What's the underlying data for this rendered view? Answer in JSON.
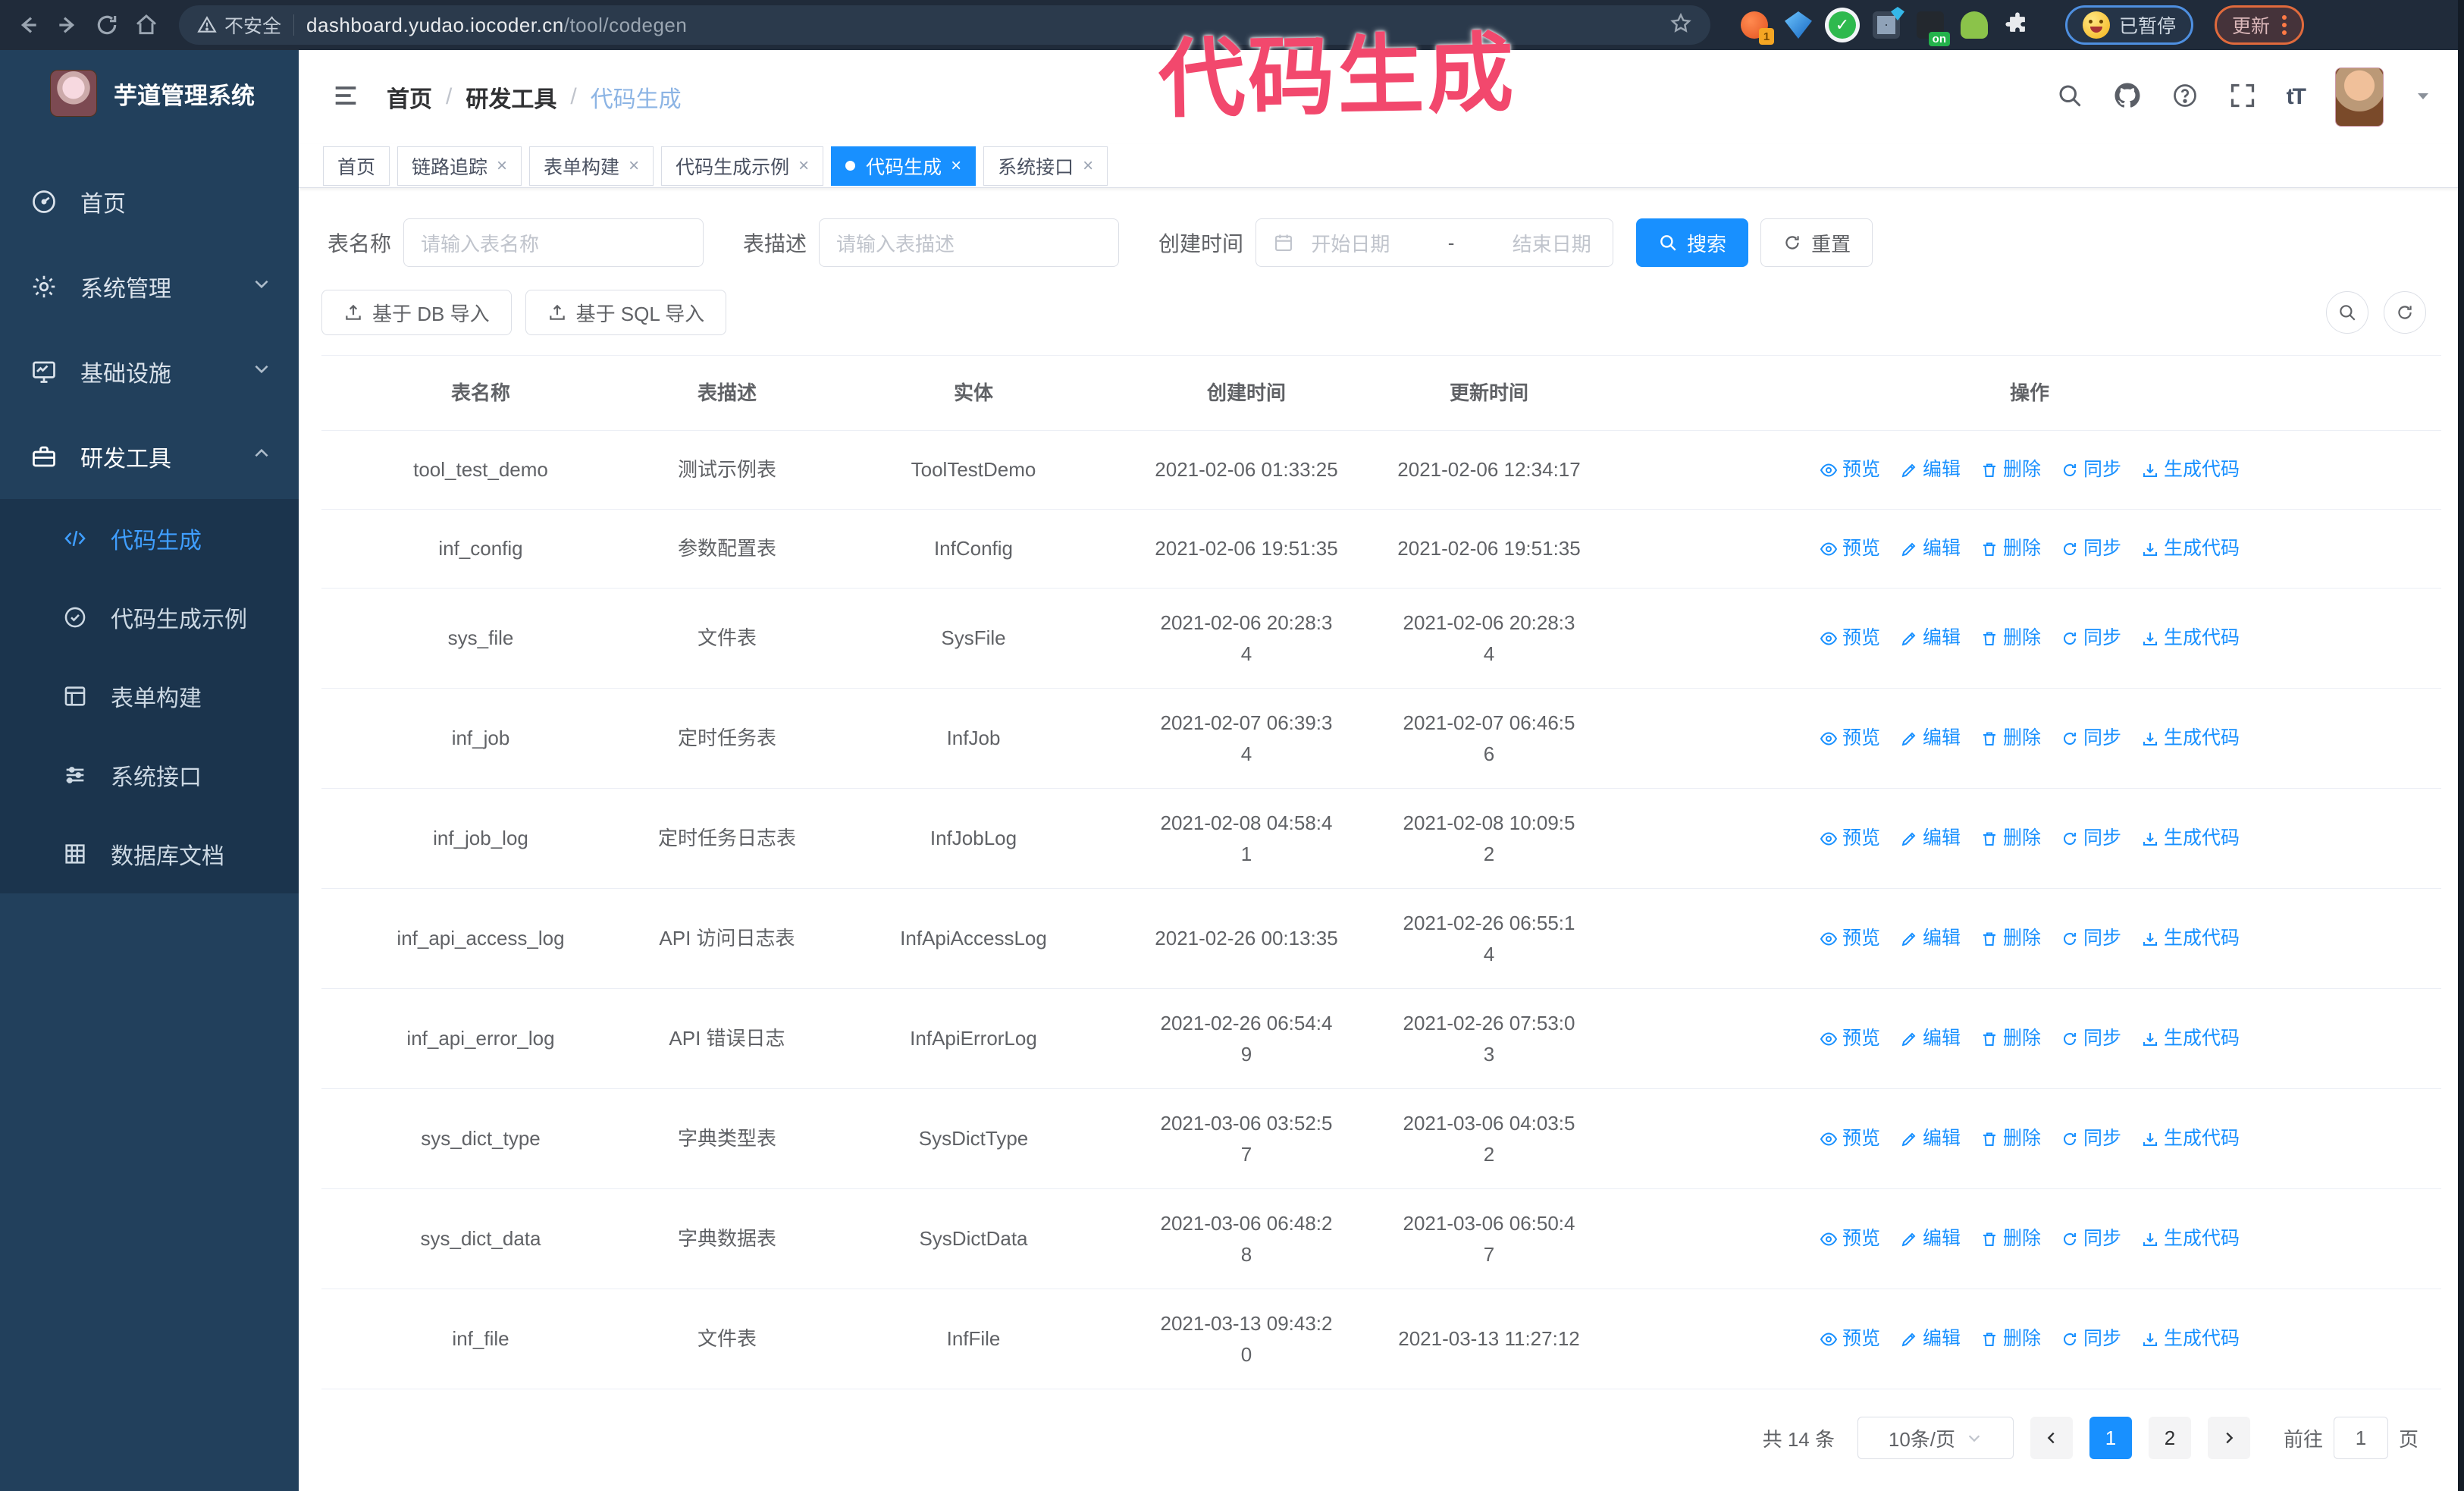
{
  "browser": {
    "security_warning": "不安全",
    "url_host": "dashboard.yudao.iocoder.cn",
    "url_path": "/tool/codegen",
    "paused_badge": "已暂停",
    "update_button": "更新"
  },
  "annotation": {
    "text": "代码生成",
    "color": "#f2486d"
  },
  "sidebar": {
    "app_title": "芋道管理系统",
    "items": [
      {
        "label": "首页"
      },
      {
        "label": "系统管理"
      },
      {
        "label": "基础设施"
      },
      {
        "label": "研发工具"
      }
    ],
    "submenu": [
      {
        "label": "代码生成"
      },
      {
        "label": "代码生成示例"
      },
      {
        "label": "表单构建"
      },
      {
        "label": "系统接口"
      },
      {
        "label": "数据库文档"
      }
    ]
  },
  "header": {
    "breadcrumb": {
      "home": "首页",
      "group": "研发工具",
      "current": "代码生成",
      "separator": "/"
    },
    "icons": {
      "font_size": "tT"
    }
  },
  "tabs": [
    {
      "label": "首页"
    },
    {
      "label": "链路追踪"
    },
    {
      "label": "表单构建"
    },
    {
      "label": "代码生成示例"
    },
    {
      "label": "代码生成"
    },
    {
      "label": "系统接口"
    }
  ],
  "tab_close_glyph": "×",
  "filters": {
    "table_name_label": "表名称",
    "table_name_placeholder": "请输入表名称",
    "table_desc_label": "表描述",
    "table_desc_placeholder": "请输入表描述",
    "create_time_label": "创建时间",
    "date_start_placeholder": "开始日期",
    "date_separator": "-",
    "date_end_placeholder": "结束日期",
    "search_button": "搜索",
    "reset_button": "重置",
    "import_db_button": "基于 DB 导入",
    "import_sql_button": "基于 SQL 导入"
  },
  "table": {
    "columns": [
      "表名称",
      "表描述",
      "实体",
      "创建时间",
      "更新时间",
      "操作"
    ],
    "actions": [
      "预览",
      "编辑",
      "删除",
      "同步",
      "生成代码"
    ],
    "rows": [
      {
        "name": "tool_test_demo",
        "desc": "测试示例表",
        "entity": "ToolTestDemo",
        "created": "2021-02-06 01:33:25",
        "updated": "2021-02-06 12:34:17"
      },
      {
        "name": "inf_config",
        "desc": "参数配置表",
        "entity": "InfConfig",
        "created": "2021-02-06 19:51:35",
        "updated": "2021-02-06 19:51:35"
      },
      {
        "name": "sys_file",
        "desc": "文件表",
        "entity": "SysFile",
        "created": "2021-02-06 20:28:34",
        "updated": "2021-02-06 20:28:34"
      },
      {
        "name": "inf_job",
        "desc": "定时任务表",
        "entity": "InfJob",
        "created": "2021-02-07 06:39:34",
        "updated": "2021-02-07 06:46:56"
      },
      {
        "name": "inf_job_log",
        "desc": "定时任务日志表",
        "entity": "InfJobLog",
        "created": "2021-02-08 04:58:41",
        "updated": "2021-02-08 10:09:52"
      },
      {
        "name": "inf_api_access_log",
        "desc": "API 访问日志表",
        "entity": "InfApiAccessLog",
        "created": "2021-02-26 00:13:35",
        "updated": "2021-02-26 06:55:14"
      },
      {
        "name": "inf_api_error_log",
        "desc": "API 错误日志",
        "entity": "InfApiErrorLog",
        "created": "2021-02-26 06:54:49",
        "updated": "2021-02-26 07:53:03"
      },
      {
        "name": "sys_dict_type",
        "desc": "字典类型表",
        "entity": "SysDictType",
        "created": "2021-03-06 03:52:57",
        "updated": "2021-03-06 04:03:52"
      },
      {
        "name": "sys_dict_data",
        "desc": "字典数据表",
        "entity": "SysDictData",
        "created": "2021-03-06 06:48:28",
        "updated": "2021-03-06 06:50:47"
      },
      {
        "name": "inf_file",
        "desc": "文件表",
        "entity": "InfFile",
        "created": "2021-03-13 09:43:20",
        "updated": "2021-03-13 11:27:12"
      }
    ]
  },
  "pagination": {
    "total_text": "共 14 条",
    "page_size": "10条/页",
    "page_1": "1",
    "page_2": "2",
    "goto_label": "前往",
    "goto_value": "1",
    "goto_suffix": "页"
  },
  "colors": {
    "primary": "#1890ff",
    "annotation": "#f2486d",
    "sidebar_bg": "#22405c",
    "submenu_bg": "#1b344d"
  }
}
